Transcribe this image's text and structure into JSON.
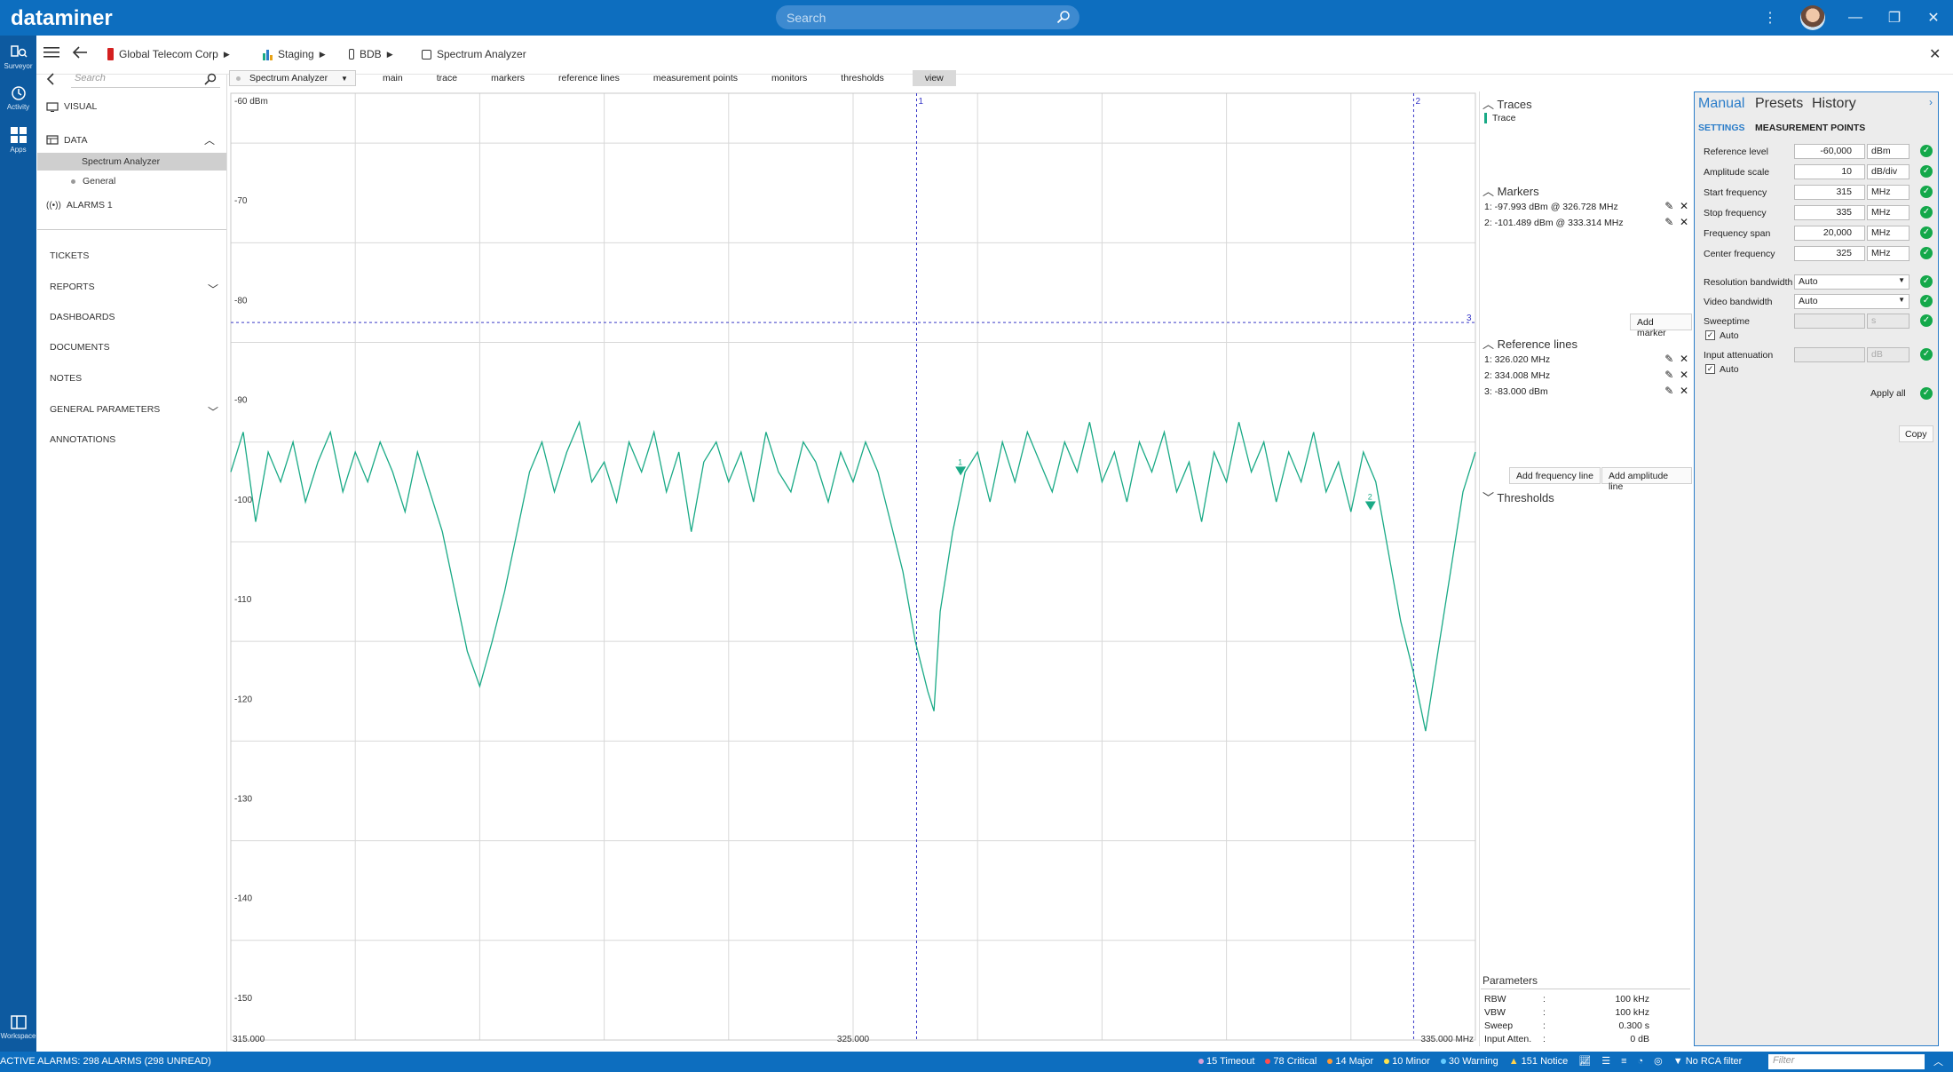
{
  "app": {
    "logo": "dataminer",
    "search_placeholder": "Search"
  },
  "rail": [
    {
      "label": "Surveyor",
      "icon": "surveyor-icon"
    },
    {
      "label": "Activity",
      "icon": "activity-icon"
    },
    {
      "label": "Apps",
      "icon": "apps-icon"
    },
    {
      "label": "Workspace",
      "icon": "workspace-icon"
    }
  ],
  "breadcrumb": [
    "Global Telecom Corp",
    "Staging",
    "BDB",
    "Spectrum Analyzer"
  ],
  "sidebar": {
    "search_placeholder": "Search",
    "visual": "VISUAL",
    "data": "DATA",
    "spectrum": "Spectrum Analyzer",
    "general": "General",
    "alarms": "ALARMS 1",
    "tickets": "TICKETS",
    "reports": "REPORTS",
    "dashboards": "DASHBOARDS",
    "documents": "DOCUMENTS",
    "notes": "NOTES",
    "general_parameters": "GENERAL PARAMETERS",
    "annotations": "ANNOTATIONS"
  },
  "tabs": {
    "dropdown": "Spectrum Analyzer",
    "items": [
      "main",
      "trace",
      "markers",
      "reference lines",
      "measurement points",
      "monitors",
      "thresholds",
      "view"
    ],
    "active": "view"
  },
  "chart_data": {
    "type": "line",
    "ylim": [
      -155,
      -60
    ],
    "xlim": [
      315,
      335
    ],
    "yticks": [
      "-60 dBm",
      "-70",
      "-80",
      "-90",
      "-100",
      "-110",
      "-120",
      "-130",
      "-140",
      "-150"
    ],
    "xticks": [
      "315.000",
      "325.000",
      "335.000 MHz"
    ],
    "series": [
      {
        "color": "#1aaa86"
      }
    ],
    "points": [
      [
        315.0,
        -98
      ],
      [
        315.2,
        -94
      ],
      [
        315.4,
        -103
      ],
      [
        315.6,
        -96
      ],
      [
        315.8,
        -99
      ],
      [
        316.0,
        -95
      ],
      [
        316.2,
        -101
      ],
      [
        316.4,
        -97
      ],
      [
        316.6,
        -94
      ],
      [
        316.8,
        -100
      ],
      [
        317.0,
        -96
      ],
      [
        317.2,
        -99
      ],
      [
        317.4,
        -95
      ],
      [
        317.6,
        -98
      ],
      [
        317.8,
        -102
      ],
      [
        318.0,
        -96
      ],
      [
        318.2,
        -100
      ],
      [
        318.4,
        -104
      ],
      [
        318.6,
        -110
      ],
      [
        318.8,
        -116
      ],
      [
        319.0,
        -119.5
      ],
      [
        319.2,
        -115
      ],
      [
        319.4,
        -110
      ],
      [
        319.6,
        -104
      ],
      [
        319.8,
        -98
      ],
      [
        320.0,
        -95
      ],
      [
        320.2,
        -100
      ],
      [
        320.4,
        -96
      ],
      [
        320.6,
        -93
      ],
      [
        320.8,
        -99
      ],
      [
        321.0,
        -97
      ],
      [
        321.2,
        -101
      ],
      [
        321.4,
        -95
      ],
      [
        321.6,
        -98
      ],
      [
        321.8,
        -94
      ],
      [
        322.0,
        -100
      ],
      [
        322.2,
        -96
      ],
      [
        322.4,
        -104
      ],
      [
        322.6,
        -97
      ],
      [
        322.8,
        -95
      ],
      [
        323.0,
        -99
      ],
      [
        323.2,
        -96
      ],
      [
        323.4,
        -101
      ],
      [
        323.6,
        -94
      ],
      [
        323.8,
        -98
      ],
      [
        324.0,
        -100
      ],
      [
        324.2,
        -95
      ],
      [
        324.4,
        -97
      ],
      [
        324.6,
        -101
      ],
      [
        324.8,
        -96
      ],
      [
        325.0,
        -99
      ],
      [
        325.2,
        -95
      ],
      [
        325.4,
        -98
      ],
      [
        325.6,
        -103
      ],
      [
        325.8,
        -108
      ],
      [
        326.0,
        -115
      ],
      [
        326.2,
        -120
      ],
      [
        326.3,
        -122
      ],
      [
        326.4,
        -112
      ],
      [
        326.6,
        -104
      ],
      [
        326.8,
        -98
      ],
      [
        327.0,
        -96
      ],
      [
        327.2,
        -101
      ],
      [
        327.4,
        -95
      ],
      [
        327.6,
        -99
      ],
      [
        327.8,
        -94
      ],
      [
        328.0,
        -97
      ],
      [
        328.2,
        -100
      ],
      [
        328.4,
        -95
      ],
      [
        328.6,
        -98
      ],
      [
        328.8,
        -93
      ],
      [
        329.0,
        -99
      ],
      [
        329.2,
        -96
      ],
      [
        329.4,
        -101
      ],
      [
        329.6,
        -95
      ],
      [
        329.8,
        -98
      ],
      [
        330.0,
        -94
      ],
      [
        330.2,
        -100
      ],
      [
        330.4,
        -97
      ],
      [
        330.6,
        -103
      ],
      [
        330.8,
        -96
      ],
      [
        331.0,
        -99
      ],
      [
        331.2,
        -93
      ],
      [
        331.4,
        -98
      ],
      [
        331.6,
        -95
      ],
      [
        331.8,
        -101
      ],
      [
        332.0,
        -96
      ],
      [
        332.2,
        -99
      ],
      [
        332.4,
        -94
      ],
      [
        332.6,
        -100
      ],
      [
        332.8,
        -97
      ],
      [
        333.0,
        -102
      ],
      [
        333.2,
        -96
      ],
      [
        333.4,
        -99
      ],
      [
        333.6,
        -106
      ],
      [
        333.8,
        -113
      ],
      [
        334.0,
        -118
      ],
      [
        334.2,
        -124
      ],
      [
        334.4,
        -116
      ],
      [
        334.6,
        -108
      ],
      [
        334.8,
        -100
      ],
      [
        335.0,
        -96
      ]
    ],
    "ref_lines": [
      {
        "label": "1",
        "freq": 326.02
      },
      {
        "label": "2",
        "freq": 334.008
      },
      {
        "label": "3",
        "level": -83
      }
    ],
    "markers": [
      {
        "label": "1",
        "freq": 326.728,
        "level": -97.993
      },
      {
        "label": "2",
        "freq": 333.314,
        "level": -101.489
      }
    ]
  },
  "traces": {
    "title": "Traces",
    "items": [
      "Trace"
    ],
    "color": "#1aaa86"
  },
  "markers_panel": {
    "title": "Markers",
    "items": [
      "1: -97.993 dBm @ 326.728 MHz",
      "2: -101.489 dBm @ 333.314 MHz"
    ],
    "add": "Add marker"
  },
  "reflines_panel": {
    "title": "Reference lines",
    "items": [
      "1: 326.020 MHz",
      "2: 334.008 MHz",
      "3: -83.000 dBm"
    ],
    "add_freq": "Add frequency line",
    "add_amp": "Add amplitude line"
  },
  "thresholds_panel": {
    "title": "Thresholds"
  },
  "parameters": {
    "title": "Parameters",
    "rows": [
      {
        "k": "RBW",
        "v": "100 kHz"
      },
      {
        "k": "VBW",
        "v": "100 kHz"
      },
      {
        "k": "Sweep",
        "v": "0.300 s"
      },
      {
        "k": "Input Atten.",
        "v": "0 dB"
      }
    ]
  },
  "settings": {
    "tabs": [
      "Manual",
      "Presets",
      "History"
    ],
    "subtabs": [
      "SETTINGS",
      "MEASUREMENT POINTS"
    ],
    "rows": [
      {
        "label": "Reference level",
        "value": "-60,000",
        "unit": "dBm"
      },
      {
        "label": "Amplitude scale",
        "value": "10",
        "unit": "dB/div"
      },
      {
        "label": "Start frequency",
        "value": "315",
        "unit": "MHz"
      },
      {
        "label": "Stop frequency",
        "value": "335",
        "unit": "MHz"
      },
      {
        "label": "Frequency span",
        "value": "20,000",
        "unit": "MHz"
      },
      {
        "label": "Center frequency",
        "value": "325",
        "unit": "MHz"
      }
    ],
    "rbw_label": "Resolution bandwidth",
    "rbw_value": "Auto",
    "vbw_label": "Video bandwidth",
    "vbw_value": "Auto",
    "sweeptime_label": "Sweeptime",
    "sweeptime_unit": "s",
    "auto": "Auto",
    "atten_label": "Input attenuation",
    "atten_unit": "dB",
    "apply_all": "Apply all",
    "copy": "Copy"
  },
  "statusbar": {
    "active_alarms": "ACTIVE ALARMS: 298 ALARMS (298 UNREAD)",
    "timeout": "15 Timeout",
    "critical": "78 Critical",
    "major": "14 Major",
    "minor": "10 Minor",
    "warning": "30 Warning",
    "notice": "151 Notice",
    "rca": "No RCA filter",
    "filter_placeholder": "Filter"
  }
}
